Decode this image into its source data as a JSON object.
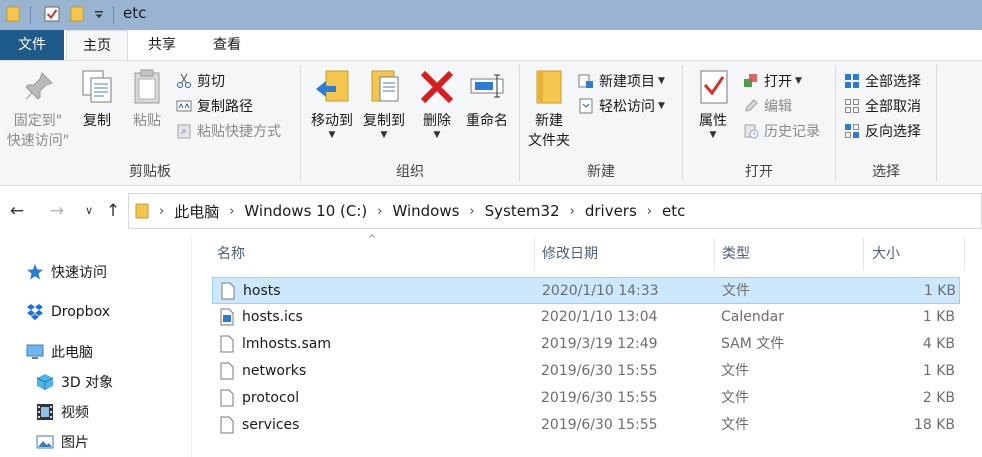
{
  "window": {
    "title": "etc"
  },
  "tabs": {
    "file": "文件",
    "home": "主页",
    "share": "共享",
    "view": "查看"
  },
  "ribbon": {
    "clipboard": {
      "label": "剪贴板",
      "pin_line1": "固定到\"",
      "pin_line2": "快速访问\"",
      "copy": "复制",
      "paste": "粘贴",
      "cut": "剪切",
      "copy_path": "复制路径",
      "paste_shortcut": "粘贴快捷方式"
    },
    "organize": {
      "label": "组织",
      "move_to": "移动到",
      "copy_to": "复制到",
      "delete": "删除",
      "rename": "重命名"
    },
    "new": {
      "label": "新建",
      "new_folder_line1": "新建",
      "new_folder_line2": "文件夹",
      "new_item": "新建项目",
      "easy_access": "轻松访问"
    },
    "open": {
      "label": "打开",
      "properties": "属性",
      "open": "打开",
      "edit": "编辑",
      "history": "历史记录"
    },
    "select": {
      "label": "选择",
      "select_all": "全部选择",
      "select_none": "全部取消",
      "invert": "反向选择"
    }
  },
  "breadcrumb": [
    "此电脑",
    "Windows 10 (C:)",
    "Windows",
    "System32",
    "drivers",
    "etc"
  ],
  "navpane": {
    "items": [
      {
        "label": "快速访问"
      },
      {
        "label": "Dropbox"
      },
      {
        "label": "此电脑"
      },
      {
        "label": "3D 对象"
      },
      {
        "label": "视频"
      },
      {
        "label": "图片"
      }
    ]
  },
  "filelist": {
    "columns": {
      "name": "名称",
      "modified": "修改日期",
      "type": "类型",
      "size": "大小"
    },
    "rows": [
      {
        "name": "hosts",
        "modified": "2020/1/10 14:33",
        "type": "文件",
        "size": "1 KB"
      },
      {
        "name": "hosts.ics",
        "modified": "2020/1/10 13:04",
        "type": "Calendar",
        "size": "1 KB"
      },
      {
        "name": "lmhosts.sam",
        "modified": "2019/3/19 12:49",
        "type": "SAM 文件",
        "size": "4 KB"
      },
      {
        "name": "networks",
        "modified": "2019/6/30 15:55",
        "type": "文件",
        "size": "1 KB"
      },
      {
        "name": "protocol",
        "modified": "2019/6/30 15:55",
        "type": "文件",
        "size": "2 KB"
      },
      {
        "name": "services",
        "modified": "2019/6/30 15:55",
        "type": "文件",
        "size": "18 KB"
      }
    ],
    "selected_row": 0
  }
}
